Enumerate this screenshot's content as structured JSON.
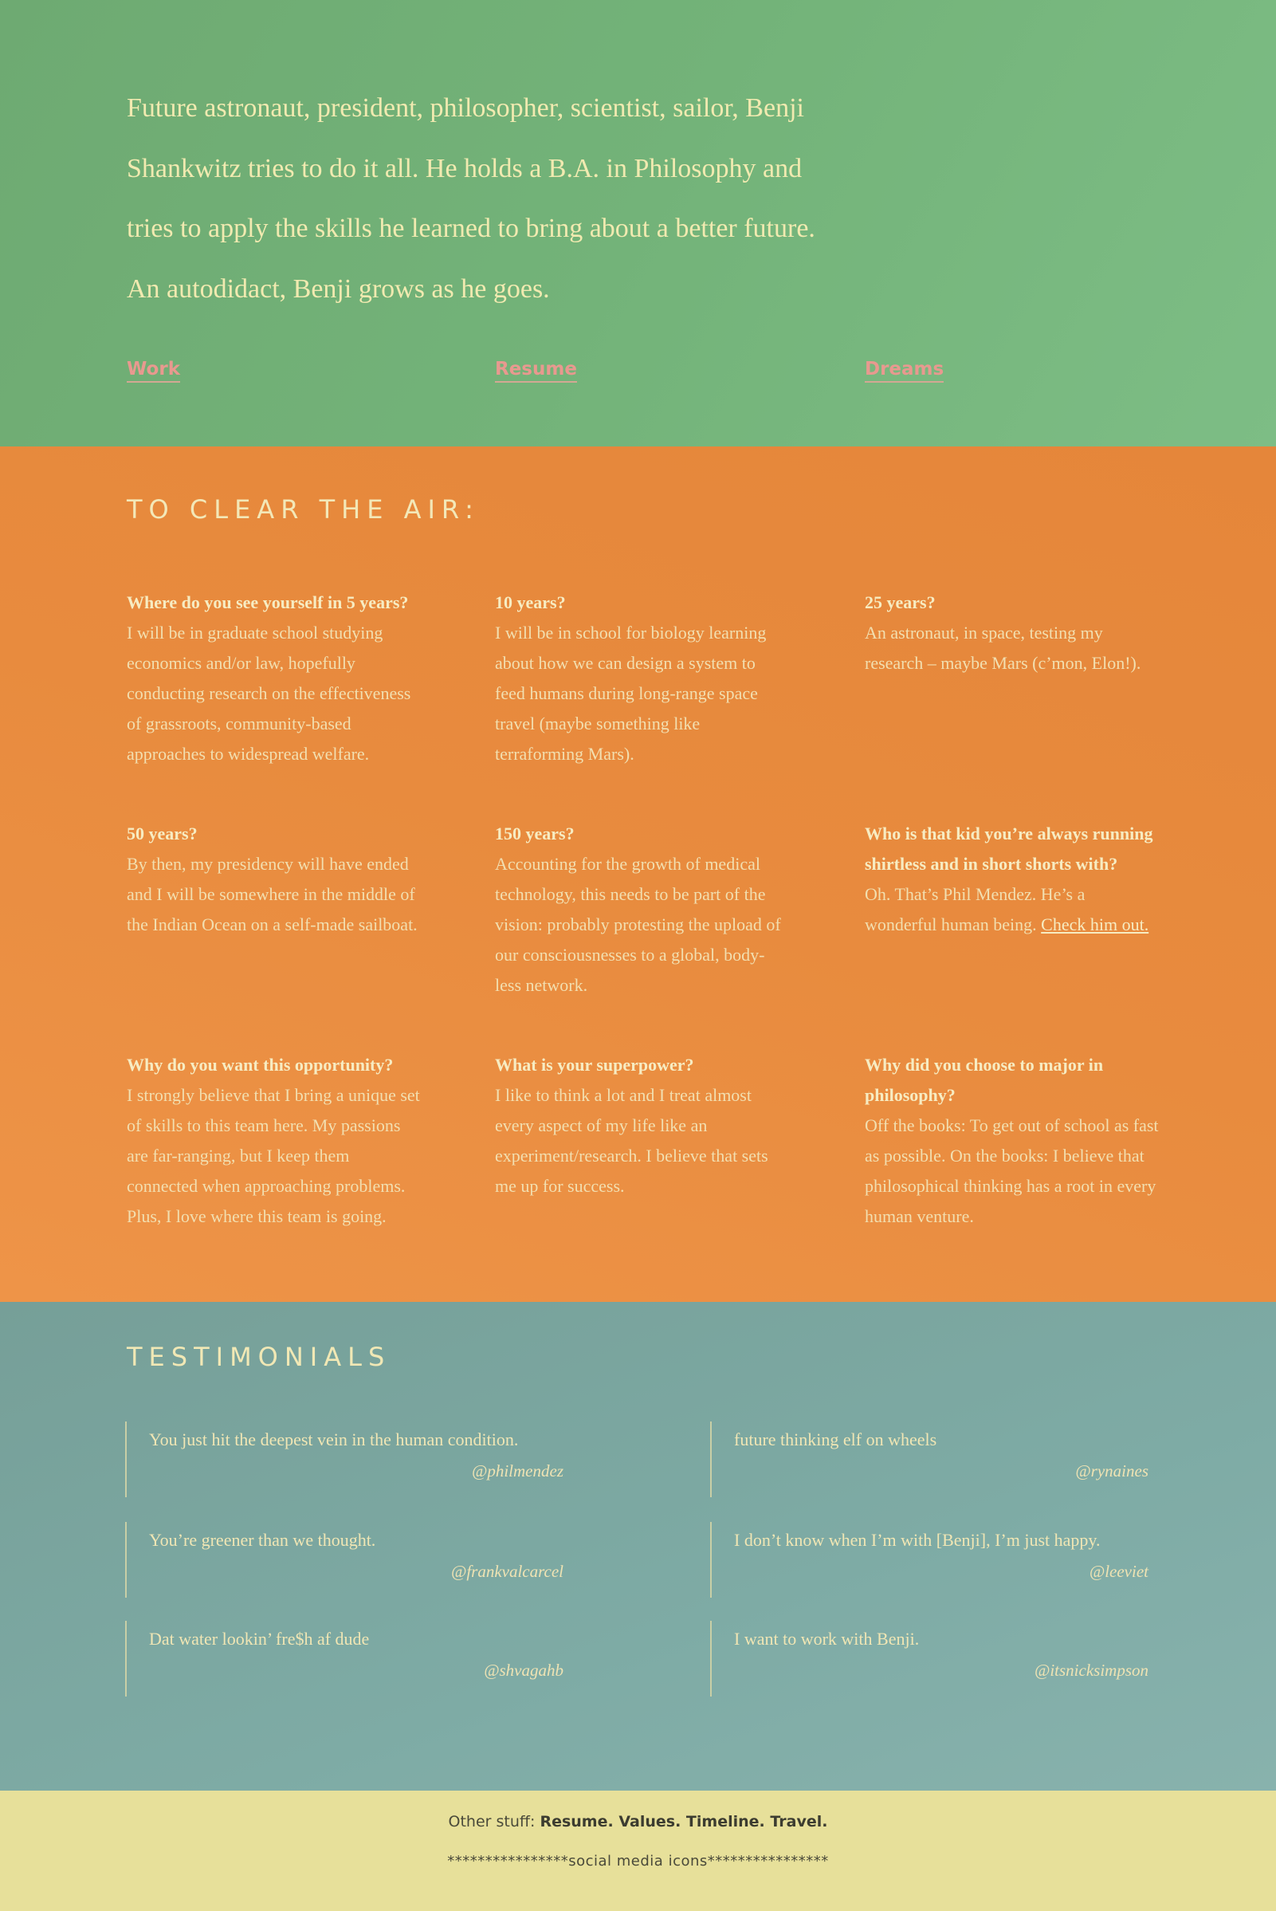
{
  "hero": {
    "bio": "Future astronaut, president, philosopher, scientist, sailor, Benji Shankwitz tries to do it all. He holds a B.A. in Philosophy and tries to apply the skills he learned to bring about a better future. An autodidact, Benji grows as he goes.",
    "nav": [
      "Work",
      "Resume",
      "Dreams"
    ]
  },
  "faq": {
    "heading": "TO CLEAR THE AIR:",
    "items": [
      {
        "q": "Where do you see yourself in 5 years?",
        "a": "I will be in graduate school studying economics and/or law, hopefully conducting research on the effectiveness of grassroots, community-based approaches to widespread welfare."
      },
      {
        "q": "10 years?",
        "a": "I will be in school for biology learning about how we can design a system to feed humans during long-range space travel (maybe something like terraforming Mars)."
      },
      {
        "q": "25 years?",
        "a": "An astronaut, in space, testing my research – maybe Mars (c’mon, Elon!)."
      },
      {
        "q": "50 years?",
        "a": "By then, my presidency will have ended and I will be somewhere in the middle of the Indian Ocean on a self-made sailboat."
      },
      {
        "q": "150 years?",
        "a": "Accounting for the growth of medical technology, this needs to be part of the vision: probably protesting the upload of our consciousnesses to a global, body-less network."
      },
      {
        "q": "Who is that kid you’re always running shirtless and in short shorts with?",
        "a": "Oh. That’s Phil Mendez. He’s a wonderful human being.",
        "link": "Check him out."
      },
      {
        "q": "Why do you want this opportunity?",
        "a": "I strongly believe that I bring a unique set of skills to this team here. My passions are far-ranging, but I keep them connected when approaching problems. Plus, I love where this team is going."
      },
      {
        "q": "What is your superpower?",
        "a": "I like to think a lot and I treat almost every aspect of my life like an experiment/research. I believe that sets me up for success."
      },
      {
        "q": "Why did you choose to major in philosophy?",
        "a": "Off the books: To get out of school as fast as possible. On the books: I believe that philosophical thinking has a root in every human venture."
      }
    ]
  },
  "testimonials": {
    "heading": "TESTIMONIALS",
    "quotes": [
      {
        "text": "You just hit the deepest vein in the human condition.",
        "who": "@philmendez"
      },
      {
        "text": "future thinking elf on wheels",
        "who": "@rynaines"
      },
      {
        "text": "You’re greener than we thought.",
        "who": "@frankvalcarcel"
      },
      {
        "text": "I don’t know when I’m with [Benji], I’m just happy.",
        "who": "@leeviet"
      },
      {
        "text": "Dat water lookin’ fre$h af dude",
        "who": "@shvagahb"
      },
      {
        "text": "I want to work with Benji.",
        "who": "@itsnicksimpson"
      }
    ]
  },
  "footer": {
    "prefix": "Other stuff: ",
    "links": [
      "Resume.",
      "Values.",
      "Timeline.",
      "Travel."
    ],
    "social": "****************social media icons****************"
  },
  "colors": {
    "hero_bg": "#73b379",
    "faq_bg": "#e88b3e",
    "testimonials_bg": "#7eaba5",
    "footer_bg": "#e7e09a",
    "nav_link": "#e8998f",
    "cream_text": "#f1eab0"
  }
}
